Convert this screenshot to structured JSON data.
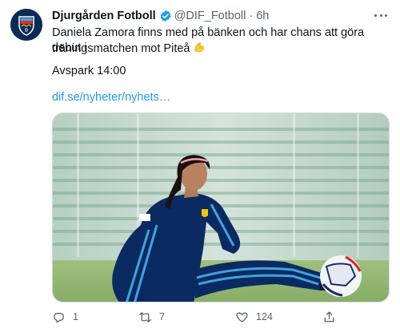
{
  "tweet": {
    "display_name": "Djurgården Fotboll",
    "verified": true,
    "handle": "@DIF_Fotboll",
    "separator": "·",
    "time": "6h",
    "text_line1": "Daniela Zamora finns med på bänken och har chans att göra debut i",
    "text_line2": "träningsmatchen mot Piteå",
    "emoji": "flexed-biceps-emoji",
    "text_line3": "Avspark 14:00",
    "link": "dif.se/nyheter/nyhets…",
    "media": {
      "description_icon": "photo-of-player-with-ball"
    },
    "actions": {
      "reply_count": "1",
      "retweet_count": "7",
      "like_count": "124",
      "share_count": ""
    }
  },
  "colors": {
    "text": "#0f1419",
    "secondary": "#536471",
    "link": "#1d9bf0",
    "verified": "#1d9bf0",
    "avatar_bg": "#0b2b57"
  }
}
